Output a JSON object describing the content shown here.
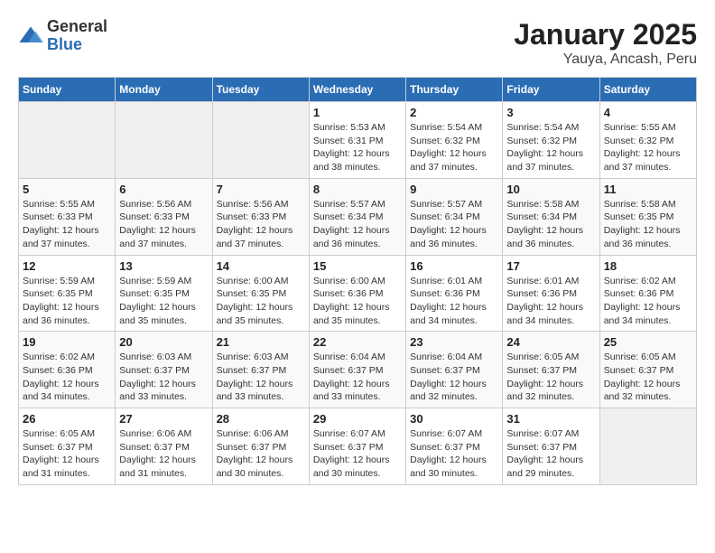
{
  "logo": {
    "general": "General",
    "blue": "Blue"
  },
  "title": "January 2025",
  "subtitle": "Yauya, Ancash, Peru",
  "weekdays": [
    "Sunday",
    "Monday",
    "Tuesday",
    "Wednesday",
    "Thursday",
    "Friday",
    "Saturday"
  ],
  "weeks": [
    [
      {
        "day": "",
        "sunrise": "",
        "sunset": "",
        "daylight": ""
      },
      {
        "day": "",
        "sunrise": "",
        "sunset": "",
        "daylight": ""
      },
      {
        "day": "",
        "sunrise": "",
        "sunset": "",
        "daylight": ""
      },
      {
        "day": "1",
        "sunrise": "Sunrise: 5:53 AM",
        "sunset": "Sunset: 6:31 PM",
        "daylight": "Daylight: 12 hours and 38 minutes."
      },
      {
        "day": "2",
        "sunrise": "Sunrise: 5:54 AM",
        "sunset": "Sunset: 6:32 PM",
        "daylight": "Daylight: 12 hours and 37 minutes."
      },
      {
        "day": "3",
        "sunrise": "Sunrise: 5:54 AM",
        "sunset": "Sunset: 6:32 PM",
        "daylight": "Daylight: 12 hours and 37 minutes."
      },
      {
        "day": "4",
        "sunrise": "Sunrise: 5:55 AM",
        "sunset": "Sunset: 6:32 PM",
        "daylight": "Daylight: 12 hours and 37 minutes."
      }
    ],
    [
      {
        "day": "5",
        "sunrise": "Sunrise: 5:55 AM",
        "sunset": "Sunset: 6:33 PM",
        "daylight": "Daylight: 12 hours and 37 minutes."
      },
      {
        "day": "6",
        "sunrise": "Sunrise: 5:56 AM",
        "sunset": "Sunset: 6:33 PM",
        "daylight": "Daylight: 12 hours and 37 minutes."
      },
      {
        "day": "7",
        "sunrise": "Sunrise: 5:56 AM",
        "sunset": "Sunset: 6:33 PM",
        "daylight": "Daylight: 12 hours and 37 minutes."
      },
      {
        "day": "8",
        "sunrise": "Sunrise: 5:57 AM",
        "sunset": "Sunset: 6:34 PM",
        "daylight": "Daylight: 12 hours and 36 minutes."
      },
      {
        "day": "9",
        "sunrise": "Sunrise: 5:57 AM",
        "sunset": "Sunset: 6:34 PM",
        "daylight": "Daylight: 12 hours and 36 minutes."
      },
      {
        "day": "10",
        "sunrise": "Sunrise: 5:58 AM",
        "sunset": "Sunset: 6:34 PM",
        "daylight": "Daylight: 12 hours and 36 minutes."
      },
      {
        "day": "11",
        "sunrise": "Sunrise: 5:58 AM",
        "sunset": "Sunset: 6:35 PM",
        "daylight": "Daylight: 12 hours and 36 minutes."
      }
    ],
    [
      {
        "day": "12",
        "sunrise": "Sunrise: 5:59 AM",
        "sunset": "Sunset: 6:35 PM",
        "daylight": "Daylight: 12 hours and 36 minutes."
      },
      {
        "day": "13",
        "sunrise": "Sunrise: 5:59 AM",
        "sunset": "Sunset: 6:35 PM",
        "daylight": "Daylight: 12 hours and 35 minutes."
      },
      {
        "day": "14",
        "sunrise": "Sunrise: 6:00 AM",
        "sunset": "Sunset: 6:35 PM",
        "daylight": "Daylight: 12 hours and 35 minutes."
      },
      {
        "day": "15",
        "sunrise": "Sunrise: 6:00 AM",
        "sunset": "Sunset: 6:36 PM",
        "daylight": "Daylight: 12 hours and 35 minutes."
      },
      {
        "day": "16",
        "sunrise": "Sunrise: 6:01 AM",
        "sunset": "Sunset: 6:36 PM",
        "daylight": "Daylight: 12 hours and 34 minutes."
      },
      {
        "day": "17",
        "sunrise": "Sunrise: 6:01 AM",
        "sunset": "Sunset: 6:36 PM",
        "daylight": "Daylight: 12 hours and 34 minutes."
      },
      {
        "day": "18",
        "sunrise": "Sunrise: 6:02 AM",
        "sunset": "Sunset: 6:36 PM",
        "daylight": "Daylight: 12 hours and 34 minutes."
      }
    ],
    [
      {
        "day": "19",
        "sunrise": "Sunrise: 6:02 AM",
        "sunset": "Sunset: 6:36 PM",
        "daylight": "Daylight: 12 hours and 34 minutes."
      },
      {
        "day": "20",
        "sunrise": "Sunrise: 6:03 AM",
        "sunset": "Sunset: 6:37 PM",
        "daylight": "Daylight: 12 hours and 33 minutes."
      },
      {
        "day": "21",
        "sunrise": "Sunrise: 6:03 AM",
        "sunset": "Sunset: 6:37 PM",
        "daylight": "Daylight: 12 hours and 33 minutes."
      },
      {
        "day": "22",
        "sunrise": "Sunrise: 6:04 AM",
        "sunset": "Sunset: 6:37 PM",
        "daylight": "Daylight: 12 hours and 33 minutes."
      },
      {
        "day": "23",
        "sunrise": "Sunrise: 6:04 AM",
        "sunset": "Sunset: 6:37 PM",
        "daylight": "Daylight: 12 hours and 32 minutes."
      },
      {
        "day": "24",
        "sunrise": "Sunrise: 6:05 AM",
        "sunset": "Sunset: 6:37 PM",
        "daylight": "Daylight: 12 hours and 32 minutes."
      },
      {
        "day": "25",
        "sunrise": "Sunrise: 6:05 AM",
        "sunset": "Sunset: 6:37 PM",
        "daylight": "Daylight: 12 hours and 32 minutes."
      }
    ],
    [
      {
        "day": "26",
        "sunrise": "Sunrise: 6:05 AM",
        "sunset": "Sunset: 6:37 PM",
        "daylight": "Daylight: 12 hours and 31 minutes."
      },
      {
        "day": "27",
        "sunrise": "Sunrise: 6:06 AM",
        "sunset": "Sunset: 6:37 PM",
        "daylight": "Daylight: 12 hours and 31 minutes."
      },
      {
        "day": "28",
        "sunrise": "Sunrise: 6:06 AM",
        "sunset": "Sunset: 6:37 PM",
        "daylight": "Daylight: 12 hours and 30 minutes."
      },
      {
        "day": "29",
        "sunrise": "Sunrise: 6:07 AM",
        "sunset": "Sunset: 6:37 PM",
        "daylight": "Daylight: 12 hours and 30 minutes."
      },
      {
        "day": "30",
        "sunrise": "Sunrise: 6:07 AM",
        "sunset": "Sunset: 6:37 PM",
        "daylight": "Daylight: 12 hours and 30 minutes."
      },
      {
        "day": "31",
        "sunrise": "Sunrise: 6:07 AM",
        "sunset": "Sunset: 6:37 PM",
        "daylight": "Daylight: 12 hours and 29 minutes."
      },
      {
        "day": "",
        "sunrise": "",
        "sunset": "",
        "daylight": ""
      }
    ]
  ]
}
